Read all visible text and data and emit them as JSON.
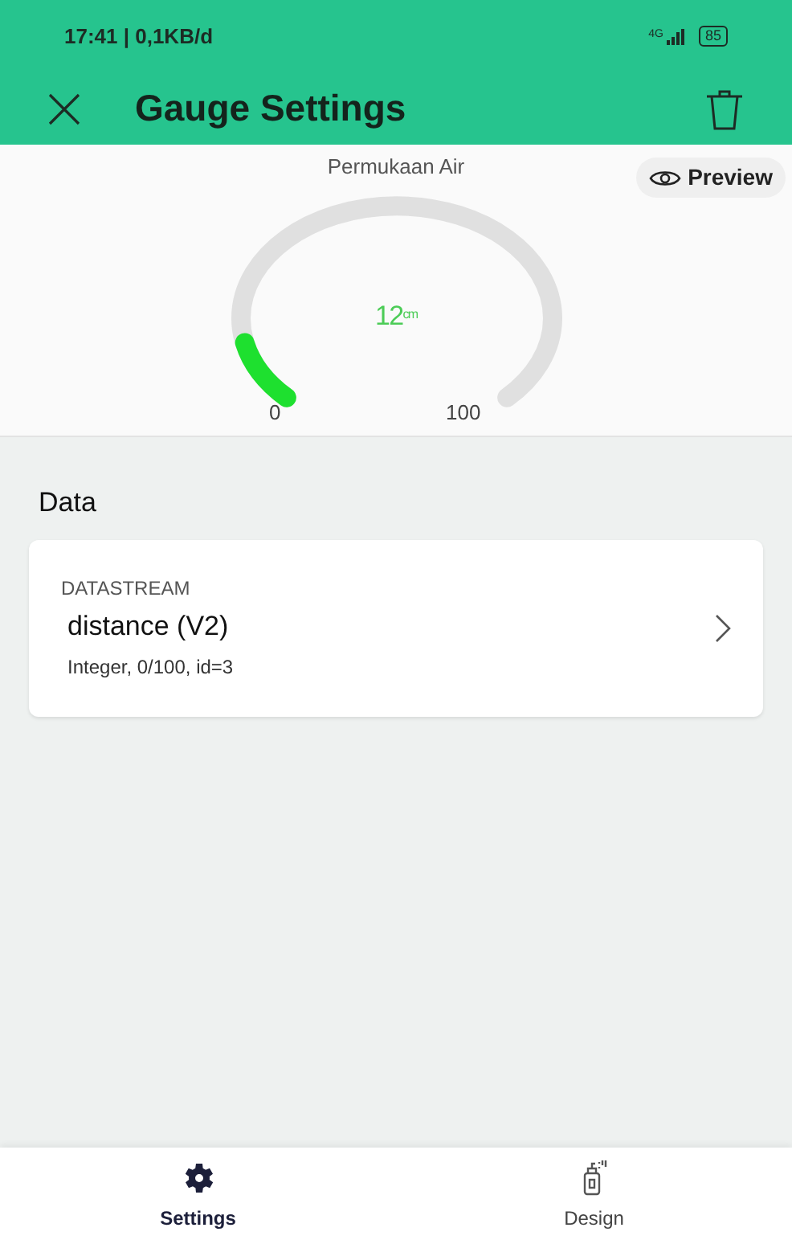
{
  "status_bar": {
    "time": "17:41 | 0,1KB/d",
    "network": "4G",
    "battery": "85"
  },
  "header": {
    "title": "Gauge Settings"
  },
  "preview": {
    "title": "Permukaan Air",
    "button": "Preview",
    "value": "12",
    "unit": "cm",
    "level": 0.12,
    "min": "0",
    "max": "100"
  },
  "data_section": {
    "heading": "Data",
    "card": {
      "label": "DATASTREAM",
      "name": "distance (V2)",
      "details": "Integer, 0/100, id=3"
    }
  },
  "bottom_nav": [
    {
      "label": "Settings",
      "kind": "gear",
      "selected": true
    },
    {
      "label": "Design",
      "kind": "spray",
      "selected": false
    }
  ]
}
